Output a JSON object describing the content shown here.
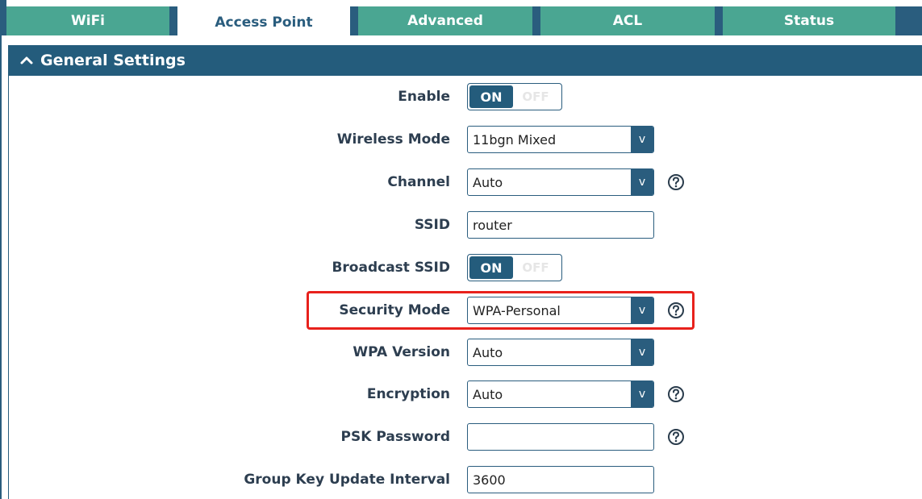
{
  "tabs": [
    {
      "label": "WiFi"
    },
    {
      "label": "Access Point"
    },
    {
      "label": "Advanced"
    },
    {
      "label": "ACL"
    },
    {
      "label": "Status"
    }
  ],
  "section": {
    "title": "General Settings",
    "icon": "chevron-up-icon"
  },
  "fields": {
    "enable": {
      "label": "Enable",
      "on_label": "ON",
      "off_label": "OFF",
      "state": "on"
    },
    "wireless_mode": {
      "label": "Wireless Mode",
      "value": "11bgn Mixed",
      "arrow": "v"
    },
    "channel": {
      "label": "Channel",
      "value": "Auto",
      "arrow": "v"
    },
    "ssid": {
      "label": "SSID",
      "value": "router"
    },
    "broadcast_ssid": {
      "label": "Broadcast SSID",
      "on_label": "ON",
      "off_label": "OFF",
      "state": "on"
    },
    "security_mode": {
      "label": "Security Mode",
      "value": "WPA-Personal",
      "arrow": "v"
    },
    "wpa_version": {
      "label": "WPA Version",
      "value": "Auto",
      "arrow": "v"
    },
    "encryption": {
      "label": "Encryption",
      "value": "Auto",
      "arrow": "v"
    },
    "psk_password": {
      "label": "PSK Password",
      "value": ""
    },
    "group_key_update_interval": {
      "label": "Group Key Update Interval",
      "value": "3600"
    }
  },
  "colors": {
    "tab": "#4aa692",
    "header": "#245c7c",
    "highlight": "#e8211c"
  }
}
